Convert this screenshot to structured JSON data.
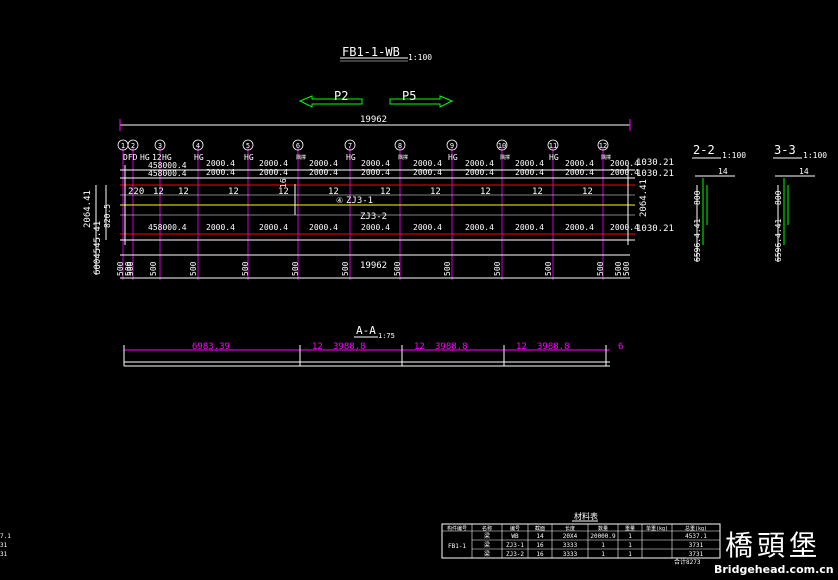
{
  "title": "FB1-1-WB",
  "title_scale": "1:100",
  "arrows": {
    "left": "P2",
    "right": "P5"
  },
  "total_length": "19962",
  "circle_labels": [
    "1",
    "2",
    "3",
    "4",
    "5",
    "6",
    "7",
    "8",
    "9",
    "10",
    "11",
    "12"
  ],
  "ring_label": "④",
  "top_start_labels": [
    "DFD",
    "HG",
    "12",
    "HG"
  ],
  "hg_label": "HG",
  "small_mark": "隅撑",
  "top_dims": [
    "2000.4",
    "2000.4",
    "2000.4",
    "2000.4",
    "2000.4",
    "2000.4",
    "2000.4",
    "2000.4",
    "2000.4"
  ],
  "top_dims_2": [
    "2000.4",
    "2000.4",
    "2000.4",
    "2000.4",
    "2000.4",
    "2000.4",
    "2000.4",
    "2000.4",
    "2000.4"
  ],
  "start_dim_top": "458000.4",
  "start_dim_mid": "458000.4",
  "top_elev": "1030.21",
  "top_elev_2": "1030.21",
  "bot_elev": "1030.21",
  "spacing": [
    "12",
    "12",
    "12",
    "12",
    "12",
    "12",
    "12",
    "12",
    "12",
    "12"
  ],
  "spacing_first": "220",
  "marker_16": "16",
  "zj_labels": [
    "ZJ3-1",
    "ZJ3-2"
  ],
  "bottom_dims": [
    "2000.4",
    "2000.4",
    "2000.4",
    "2000.4",
    "2000.4",
    "2000.4",
    "2000.4",
    "2000.4",
    "2000.4"
  ],
  "bottom_dim_start": "458000.4",
  "left_vertical": [
    "2064.41",
    "6004545.41"
  ],
  "left_vertical_small": "820.5",
  "right_vertical": "2064.41",
  "bottom_total": "19962",
  "bottom_500": [
    "500",
    "500",
    "500",
    "500",
    "500",
    "500",
    "500",
    "500",
    "500",
    "500",
    "500",
    "500",
    "500",
    "500",
    "500"
  ],
  "section22": {
    "title": "2-2",
    "scale": "1:100",
    "dim": "14",
    "v1": "800",
    "v2": "6596.4.41"
  },
  "section33": {
    "title": "3-3",
    "scale": "1:100",
    "dim": "14",
    "v1": "800",
    "v2": "6596.4.41"
  },
  "aa": {
    "title": "A-A",
    "scale": "1:75",
    "dims": [
      "6983.39",
      "12",
      "3988.8",
      "12",
      "3988.8",
      "12",
      "3988.8",
      "6"
    ]
  },
  "table": {
    "title": "材料表",
    "header": [
      "构件编号",
      "名称",
      "编号",
      "截面",
      "长度",
      "数量",
      "重量",
      "单重(kg)",
      "总重(kg)"
    ],
    "group": "FB1-1",
    "rows": [
      [
        "梁",
        "WB",
        "14",
        "20X4",
        "20000.9",
        "1",
        "",
        "4537.1",
        "4537.1"
      ],
      [
        "梁",
        "ZJ3-1",
        "16",
        "3333",
        "1",
        "1",
        "",
        "3731",
        "3731"
      ],
      [
        "梁",
        "ZJ3-2",
        "16",
        "3333",
        "1",
        "1",
        "",
        "3731",
        "3731"
      ]
    ],
    "total": "合计8273"
  },
  "watermark": {
    "cn": "橋頭堡",
    "url": "Bridgehead.com.cn"
  },
  "colors": {
    "white": "#ffffff",
    "magenta": "#ff00ff",
    "green": "#00ff00",
    "red": "#ff0000",
    "yellow": "#ffff00",
    "cyan": "#00ffff"
  }
}
